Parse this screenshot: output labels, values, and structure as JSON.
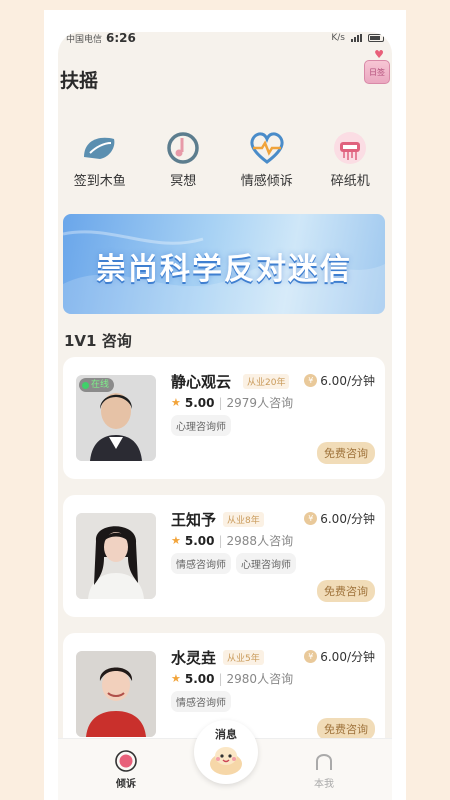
{
  "status": {
    "carrier": "中国电信",
    "time": "6:26",
    "speed": "K/s"
  },
  "header": {
    "title": "扶摇",
    "diary_label": "日签"
  },
  "quick": [
    {
      "label": "签到木鱼",
      "icon": "wooden-fish-icon",
      "color": "#5b8fb0"
    },
    {
      "label": "冥想",
      "icon": "meditation-icon",
      "color": "#5c7d8e"
    },
    {
      "label": "情感倾诉",
      "icon": "heart-pulse-icon",
      "color": "#4a8cc9"
    },
    {
      "label": "碎纸机",
      "icon": "shredder-icon",
      "color": "#e0627e"
    }
  ],
  "banner": {
    "text": "崇尚科学反对迷信"
  },
  "section_title": "1V1 咨询",
  "consultants": [
    {
      "name": "静心观云",
      "years": "从业20年",
      "price": "6.00/分钟",
      "rating": "5.00",
      "consults": "2979人咨询",
      "tags": [
        "心理咨询师"
      ],
      "cta": "免费咨询",
      "online": "在线"
    },
    {
      "name": "王知予",
      "years": "从业8年",
      "price": "6.00/分钟",
      "rating": "5.00",
      "consults": "2988人咨询",
      "tags": [
        "情感咨询师",
        "心理咨询师"
      ],
      "cta": "免费咨询"
    },
    {
      "name": "水灵垚",
      "years": "从业5年",
      "price": "6.00/分钟",
      "rating": "5.00",
      "consults": "2980人咨询",
      "tags": [
        "情感咨询师"
      ],
      "cta": "免费咨询"
    }
  ],
  "tabs": {
    "listen": "倾诉",
    "message": "消息",
    "mine": "本我"
  },
  "colors": {
    "accent": "#c99a5a",
    "cta_bg": "#f1dcb8",
    "page_bg": "#f6f2ec"
  }
}
